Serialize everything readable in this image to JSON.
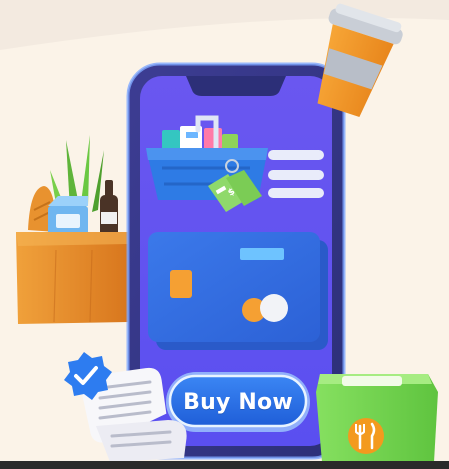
{
  "cta": {
    "label": "Buy Now"
  },
  "icons": {
    "coffee_cup": "coffee-cup-icon",
    "grocery_bag": "grocery-bag-icon",
    "shopping_basket": "shopping-basket-icon",
    "price_tag": "price-tag-icon",
    "credit_card": "credit-card-icon",
    "receipt": "receipt-icon",
    "verified_badge": "verified-badge-icon",
    "food_box": "food-delivery-box-icon",
    "utensils": "fork-knife-icon"
  },
  "colors": {
    "background": "#fbf3e8",
    "phone_frame": "#3b3f8f",
    "screen": "#5b5bf0",
    "card": "#2f6fe0",
    "button": "#2b73ea",
    "coffee_orange": "#f39a1e",
    "bag_orange": "#e6892a",
    "box_green": "#7ed957",
    "badge_blue": "#2d7cf0"
  }
}
